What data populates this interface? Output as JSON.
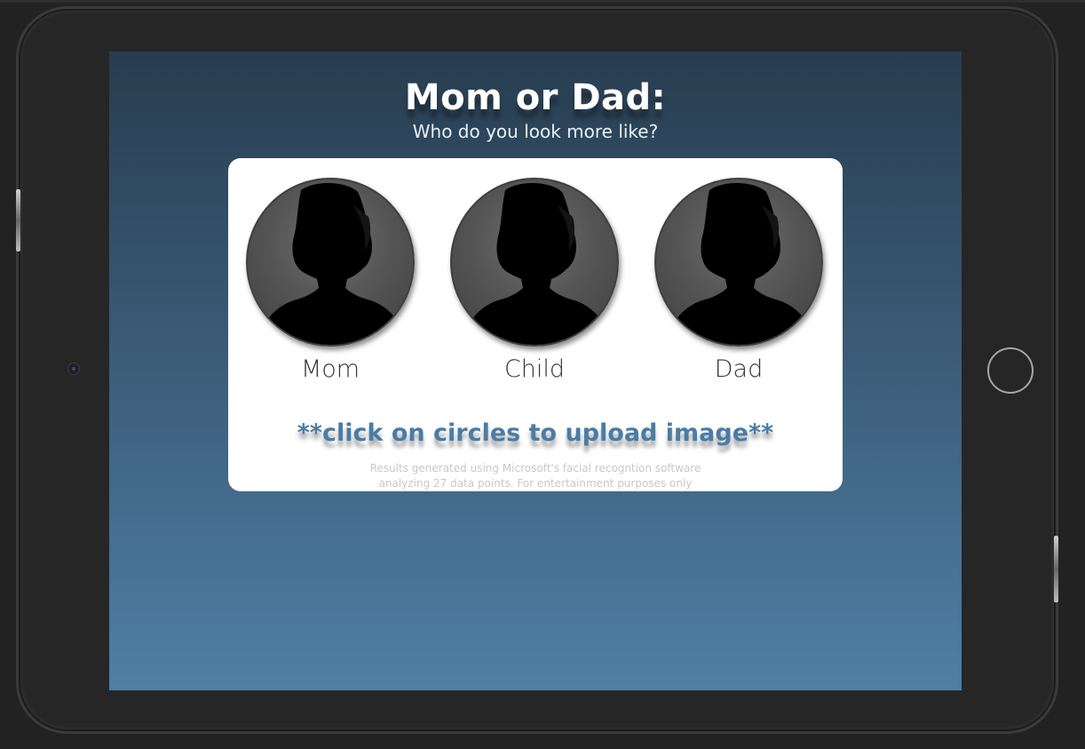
{
  "app": {
    "title": "Mom or Dad:",
    "subtitle": "Who do you look more like?"
  },
  "slots": [
    {
      "label": "Mom",
      "icon": "person-silhouette-icon"
    },
    {
      "label": "Child",
      "icon": "person-silhouette-icon"
    },
    {
      "label": "Dad",
      "icon": "person-silhouette-icon"
    }
  ],
  "instructions": "**click on circles to upload image**",
  "disclaimer": {
    "line1": "Results generated using Microsoft's facial recogntion software",
    "line2": "analyzing 27 data points. For entertainment purposes only"
  },
  "colors": {
    "accent": "#4a7ca5",
    "screen_top": "#283d4f",
    "screen_bottom": "#4f7fa6",
    "bezel": "#262626"
  }
}
